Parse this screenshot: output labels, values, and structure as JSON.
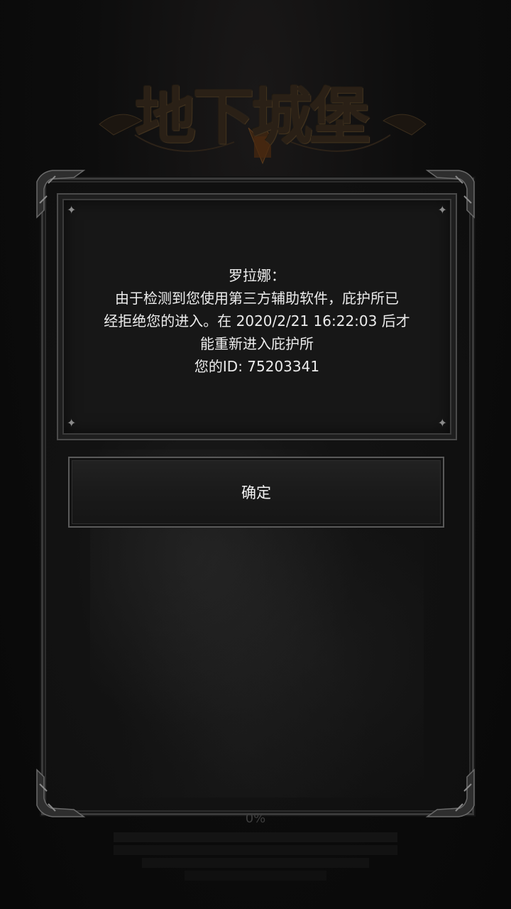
{
  "game": {
    "title_logo": "地下城堡"
  },
  "dialog": {
    "lines": [
      "罗拉娜：",
      "由于检测到您使用第三方辅助软件，庇护所已",
      "经拒绝您的进入。在 2020/2/21 16:22:03 后才",
      "能重新进入庇护所",
      "您的ID: 75203341"
    ],
    "confirm_label": "确定"
  },
  "loading": {
    "progress_text": "0%",
    "progress": 0
  },
  "colors": {
    "background": "#0b0b0b",
    "panel": "#171717",
    "text": "#ececec",
    "frame": "#4a4a4a"
  }
}
